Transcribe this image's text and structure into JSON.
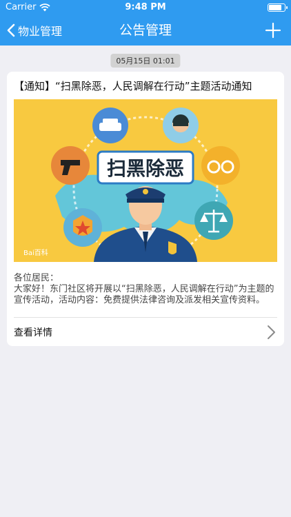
{
  "status_bar": {
    "carrier": "Carrier",
    "time": "9:48 PM",
    "battery_level": 0.85
  },
  "nav": {
    "back_label": "物业管理",
    "title": "公告管理",
    "add_icon": "plus-icon"
  },
  "announcement": {
    "date": "05月15日 01:01",
    "title": "【通知】“扫黑除恶，人民调解在行动”主题活动通知",
    "image": {
      "banner_text": "扫黑除恶",
      "watermark": "Bai百科"
    },
    "greeting": "各位居民：",
    "body": "大家好！东门社区将开展以“扫黑除恶，人民调解在行动”为主题的宣传活动，活动内容：免费提供法律咨询及派发相关宣传资料。",
    "detail_label": "查看详情"
  },
  "colors": {
    "nav_bg": "#2f9bf0",
    "page_bg": "#efeff4",
    "banner_bg": "#f8c940"
  }
}
